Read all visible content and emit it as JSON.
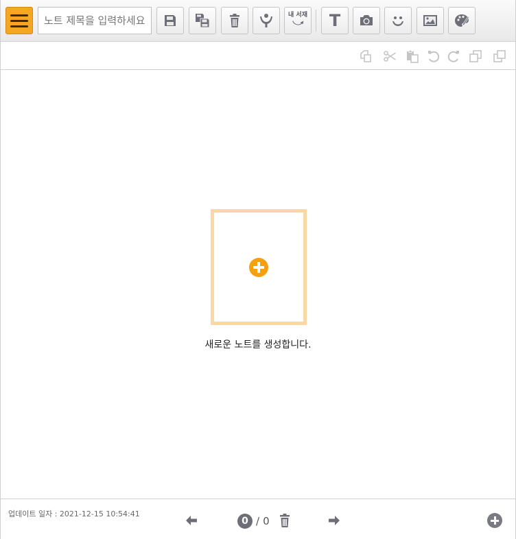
{
  "toolbar": {
    "title_placeholder": "노트 제목을 입력하세요",
    "my_library_label": "내 서재",
    "text_tool_glyph": "T",
    "buttons": [
      "menu-icon",
      "save-icon",
      "save-as-icon",
      "trash-icon",
      "share-icon",
      "my-library-icon",
      "text-icon",
      "camera-icon",
      "sticker-icon",
      "image-icon",
      "palette-icon"
    ]
  },
  "edit_bar": {
    "buttons": [
      "copy-icon",
      "cut-icon",
      "paste-icon",
      "undo-icon",
      "redo-icon",
      "bring-front-icon",
      "send-back-icon"
    ]
  },
  "content": {
    "new_note_label": "새로운 노트를 생성합니다."
  },
  "footer": {
    "updated_text": "업데이트 일자 : 2021-12-15 10:54:41",
    "current_page": "0",
    "page_separator": "/",
    "total_pages": "0"
  },
  "colors": {
    "accent": "#f5a623",
    "new_note_border": "#fbd7a6",
    "plus": "#f5a00f",
    "icon": "#6e6e78",
    "disabled_icon": "#c4c4c4"
  }
}
